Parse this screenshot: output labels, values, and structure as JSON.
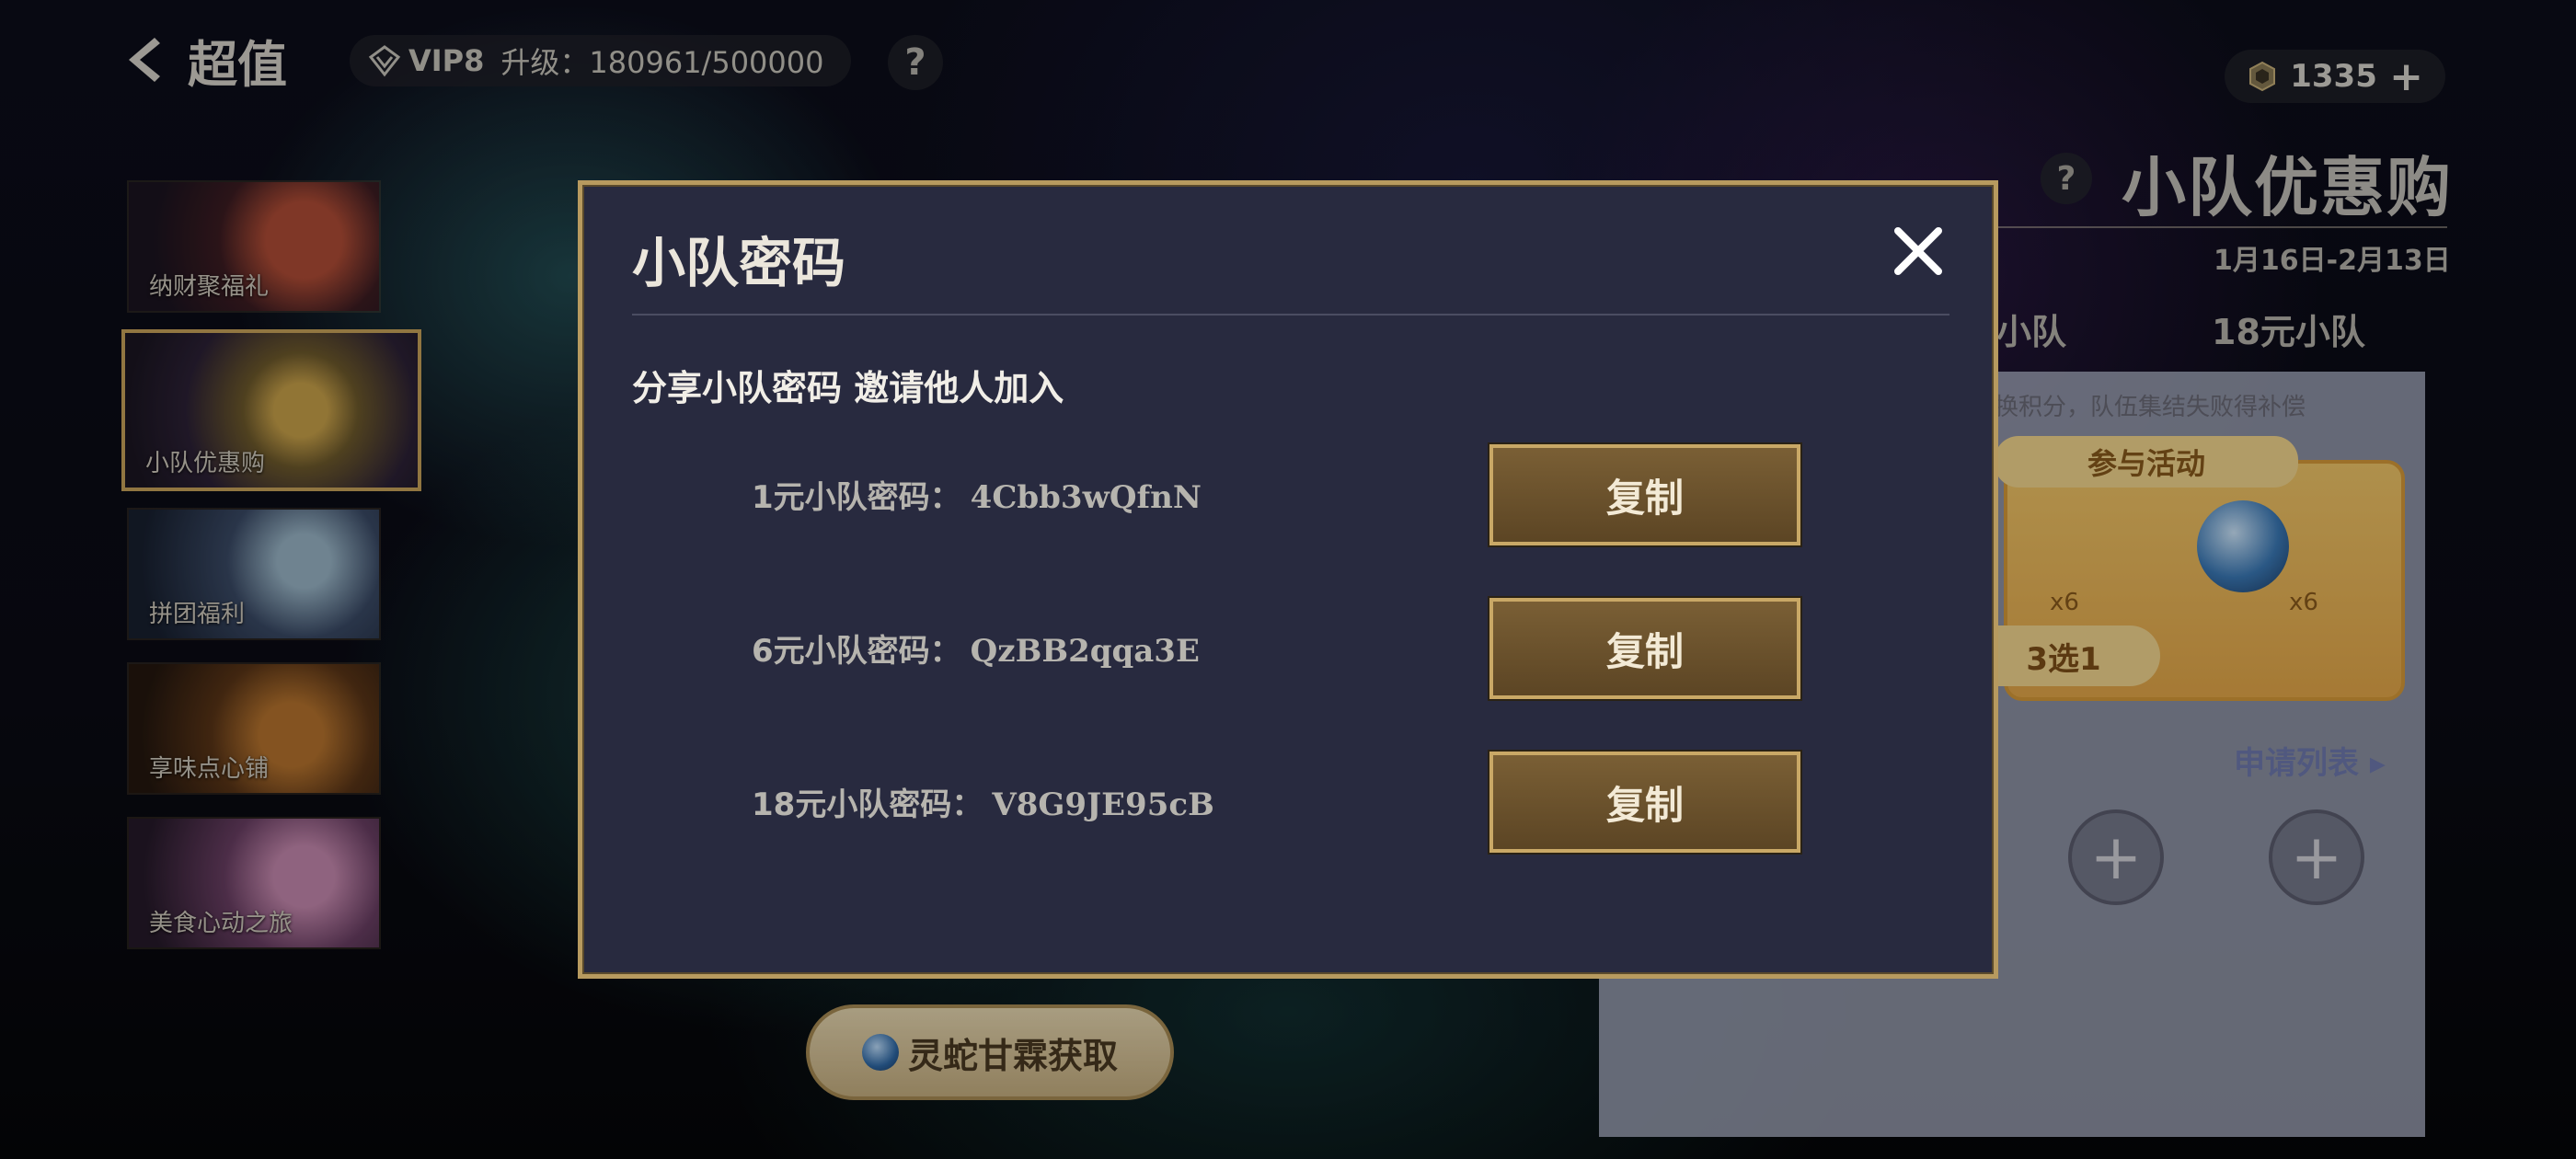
{
  "header": {
    "back_label": "超值",
    "vip_label": "VIP8",
    "upgrade_label": "升级：180961/500000",
    "help_glyph": "?",
    "currency_value": "1335",
    "currency_plus": "+"
  },
  "sidebar": {
    "items": [
      {
        "label": "纳财聚福礼"
      },
      {
        "label": "小队优惠购"
      },
      {
        "label": "拼团福利"
      },
      {
        "label": "享味点心铺"
      },
      {
        "label": "美食心动之旅"
      }
    ]
  },
  "panel": {
    "help_glyph": "?",
    "title": "小队优惠购",
    "date_range": "1月16日-2月13日",
    "tab_partial": "小队",
    "tab_18": "18元小队",
    "note": "换积分，队伍集结失败得补偿",
    "banner_head": "参与活动",
    "reward_count_1": "x6",
    "reward_count_2": "x6",
    "pick_label": "3选1",
    "apply_list": "申请列表 ▸",
    "plus_glyph": "+"
  },
  "bottom_button": {
    "label": "灵蛇甘霖获取"
  },
  "modal": {
    "title": "小队密码",
    "subtitle": "分享小队密码 邀请他人加入",
    "rows": [
      {
        "label": "1元小队密码：",
        "code": "4Cbb3wQfnN",
        "button": "复制"
      },
      {
        "label": "6元小队密码：",
        "code": "QzBB2qqa3E",
        "button": "复制"
      },
      {
        "label": "18元小队密码：",
        "code": "V8G9JE95cB",
        "button": "复制"
      }
    ]
  },
  "colors": {
    "modal_bg": "#282a3f",
    "modal_border": "#b79a5f",
    "copy_button": "#6b5230",
    "text_primary": "#ebe6dc"
  }
}
